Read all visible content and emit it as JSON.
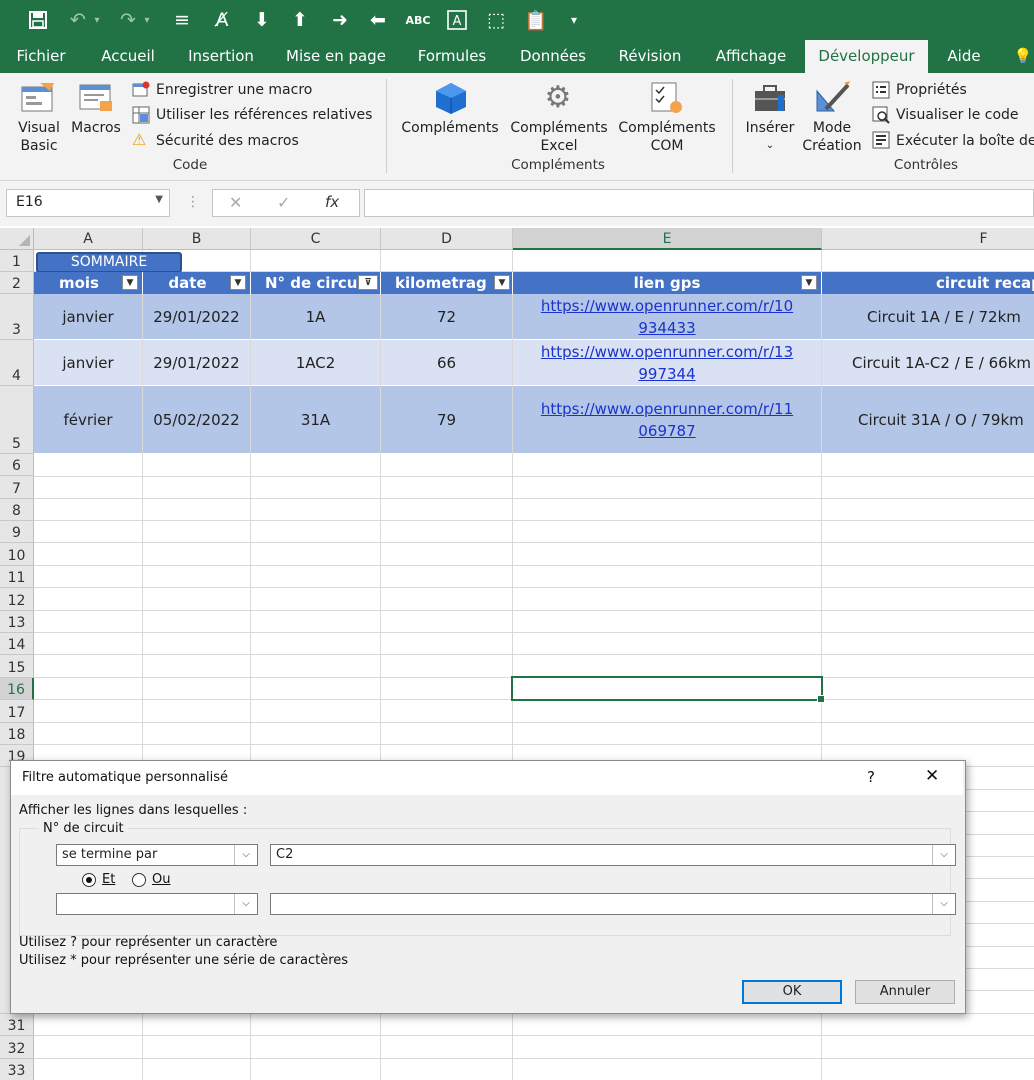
{
  "qat": {
    "save_icon": "save-icon",
    "undo_icon": "undo-icon",
    "redo_icon": "redo-icon",
    "more_label": "▾"
  },
  "tabs": [
    "Fichier",
    "Accueil",
    "Insertion",
    "Mise en page",
    "Formules",
    "Données",
    "Révision",
    "Affichage",
    "Développeur",
    "Aide"
  ],
  "active_tab": "Développeur",
  "ribbon": {
    "code": {
      "visual_basic": "Visual\nBasic",
      "macros": "Macros",
      "record_macro": "Enregistrer une macro",
      "relative_refs": "Utiliser les références relatives",
      "macro_security": "Sécurité des macros",
      "group": "Code"
    },
    "addins": {
      "complements": "Compléments",
      "excel_complements_1": "Compléments",
      "excel_complements_2": "Excel",
      "com_complements_1": "Compléments",
      "com_complements_2": "COM",
      "group": "Compléments"
    },
    "controls": {
      "insert": "Insérer",
      "design_mode_1": "Mode",
      "design_mode_2": "Création",
      "properties": "Propriétés",
      "view_code": "Visualiser le code",
      "run_dialog": "Exécuter la boîte de",
      "group": "Contrôles"
    }
  },
  "formula_bar": {
    "name_box": "E16",
    "fx": "fx",
    "value": ""
  },
  "columns": [
    "A",
    "B",
    "C",
    "D",
    "E",
    "F"
  ],
  "selected_cell": {
    "column": "E",
    "row": "16"
  },
  "rows": [
    "1",
    "2",
    "3",
    "4",
    "5",
    "6",
    "7",
    "8",
    "9",
    "10",
    "11",
    "12",
    "13",
    "14",
    "15",
    "16",
    "17",
    "18",
    "19",
    "31",
    "32",
    "33"
  ],
  "sheet": {
    "sommaire_button": "SOMMAIRE",
    "headers": [
      "mois",
      "date",
      "N° de circuit",
      "kilometrage",
      "lien gps",
      "circuit recap"
    ],
    "header_visible": [
      "mois",
      "date",
      "N° de circui",
      "kilometrag",
      "lien gps",
      "circuit recap"
    ],
    "data": [
      [
        "janvier",
        "29/01/2022",
        "1A",
        "72",
        "https://www.openrunner.com/r/10",
        "934433",
        "Circuit 1A / E / 72km"
      ],
      [
        "janvier",
        "29/01/2022",
        "1AC2",
        "66",
        "https://www.openrunner.com/r/13",
        "997344",
        "Circuit 1A-C2 / E / 66km"
      ],
      [
        "février",
        "05/02/2022",
        "31A",
        "79",
        "https://www.openrunner.com/r/11",
        "069787",
        "Circuit 31A / O / 79km"
      ]
    ]
  },
  "dialog": {
    "title": "Filtre automatique personnalisé",
    "help": "?",
    "close": "✕",
    "show_rows": "Afficher les lignes dans lesquelles :",
    "field": "N° de circuit",
    "op1": "se termine par",
    "val1": "C2",
    "and_label": "Et",
    "or_label": "Ou",
    "op2": "",
    "val2": "",
    "hint1": "Utilisez ? pour représenter un caractère",
    "hint2": "Utilisez * pour représenter une série de caractères",
    "ok": "OK",
    "cancel": "Annuler"
  },
  "colors": {
    "excel_green": "#217346",
    "table_header": "#4472c4",
    "row_dark": "#b4c6e7",
    "row_light": "#d9e1f2"
  }
}
